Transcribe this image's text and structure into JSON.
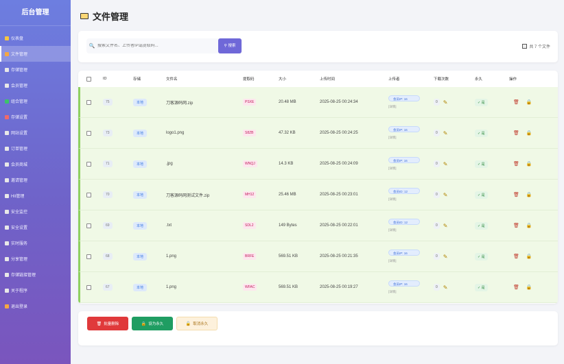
{
  "sidebar": {
    "title": "后台管理",
    "items": [
      {
        "label": "仪表盘",
        "icon": "dashboard-icon",
        "color": "#f5c542"
      },
      {
        "label": "文件管理",
        "icon": "folder-icon",
        "color": "#f5a742",
        "active": true
      },
      {
        "label": "存储管理",
        "icon": "storage-icon",
        "color": "#e8e8e8"
      },
      {
        "label": "会员管理",
        "icon": "member-icon",
        "color": "#e8e8e8"
      },
      {
        "label": "组合管理",
        "icon": "group-icon",
        "color": "#3bc46a"
      },
      {
        "label": "存储设置",
        "icon": "storage-settings-icon",
        "color": "#f06a6a"
      },
      {
        "label": "网站设置",
        "icon": "globe-icon",
        "color": "#e8e8e8"
      },
      {
        "label": "订单管理",
        "icon": "order-icon",
        "color": "#e8e8e8"
      },
      {
        "label": "会员商城",
        "icon": "shop-icon",
        "color": "#e8e8e8"
      },
      {
        "label": "邀请管理",
        "icon": "link-icon",
        "color": "#e8e8e8"
      },
      {
        "label": "Hit管理",
        "icon": "hit-icon",
        "color": "#e8e8e8"
      },
      {
        "label": "安全监控",
        "icon": "shield-icon",
        "color": "#e8e8e8"
      },
      {
        "label": "安全设置",
        "icon": "lock-icon",
        "color": "#e8e8e8"
      },
      {
        "label": "实时服务",
        "icon": "service-icon",
        "color": "#e8e8e8"
      },
      {
        "label": "分享管理",
        "icon": "share-icon",
        "color": "#e8e8e8"
      },
      {
        "label": "存储链接管理",
        "icon": "chain-icon",
        "color": "#e8e8e8"
      },
      {
        "label": "关于程序",
        "icon": "info-icon",
        "color": "#e8e8e8"
      },
      {
        "label": "退出登录",
        "icon": "logout-icon",
        "color": "#f5a742"
      }
    ]
  },
  "page": {
    "title": "文件管理"
  },
  "search": {
    "placeholder": "搜索文件名、上传者IP或提取码...",
    "button_label": "搜索",
    "total_text": "共 7 个文件"
  },
  "table": {
    "headers": {
      "id": "ID",
      "storage": "存储",
      "name": "文件名",
      "code": "提取码",
      "size": "大小",
      "time": "上传时间",
      "uploader": "上传者",
      "downloads": "下载次数",
      "permanent": "永久",
      "actions": "操作"
    },
    "rows": [
      {
        "id": "75",
        "storage": "本地",
        "name": "刀客源码网.zip",
        "code": "PSXE",
        "size": "20.48 MB",
        "time": "2025-08-25 00:24:34",
        "uploader": "会员IP: 16",
        "uploader_sub": "[详情]",
        "downloads": "0",
        "permanent": "✓ 是"
      },
      {
        "id": "73",
        "storage": "本地",
        "name": "logo1.png",
        "code": "S8ZB",
        "size": "47.32 KB",
        "time": "2025-08-25 00:24:25",
        "uploader": "会员IP: 16",
        "uploader_sub": "[详情]",
        "downloads": "0",
        "permanent": "✓ 是"
      },
      {
        "id": "71",
        "storage": "本地",
        "name": ".jpg",
        "code": "WNQJ",
        "size": "14.3 KB",
        "time": "2025-08-25 00:24:09",
        "uploader": "会员IP: 16",
        "uploader_sub": "[详情]",
        "downloads": "0",
        "permanent": "✓ 是"
      },
      {
        "id": "70",
        "storage": "本地",
        "name": "刀客源码网测试文件.zip",
        "code": "MH12",
        "size": "25.46 MB",
        "time": "2025-08-25 00:23:01",
        "uploader": "会员ID: 12",
        "uploader_sub": "[详情]",
        "downloads": "0",
        "permanent": "✓ 是"
      },
      {
        "id": "69",
        "storage": "本地",
        "name": ".txt",
        "code": "SDL2",
        "size": "149 Bytes",
        "time": "2025-08-25 00:22:01",
        "uploader": "会员ID: 12",
        "uploader_sub": "[详情]",
        "downloads": "0",
        "permanent": "✓ 是"
      },
      {
        "id": "68",
        "storage": "本地",
        "name": "1.png",
        "code": "BRFE",
        "size": "569.51 KB",
        "time": "2025-08-25 00:21:35",
        "uploader": "会员IP: 16",
        "uploader_sub": "[详情]",
        "downloads": "0",
        "permanent": "✓ 是"
      },
      {
        "id": "67",
        "storage": "本地",
        "name": "1.png",
        "code": "WFAC",
        "size": "569.51 KB",
        "time": "2025-08-25 00:19:27",
        "uploader": "会员IP: 16",
        "uploader_sub": "[详情]",
        "downloads": "0",
        "permanent": "✓ 是"
      }
    ]
  },
  "actions": {
    "batch_delete": "批量删除",
    "set_permanent": "设为永久",
    "cancel_permanent": "取消永久"
  },
  "colors": {
    "accent": "#6f68d8",
    "row_bg": "#f0f9e6",
    "row_border": "#8fd061",
    "danger": "#e0393b",
    "success": "#1f9d62"
  }
}
